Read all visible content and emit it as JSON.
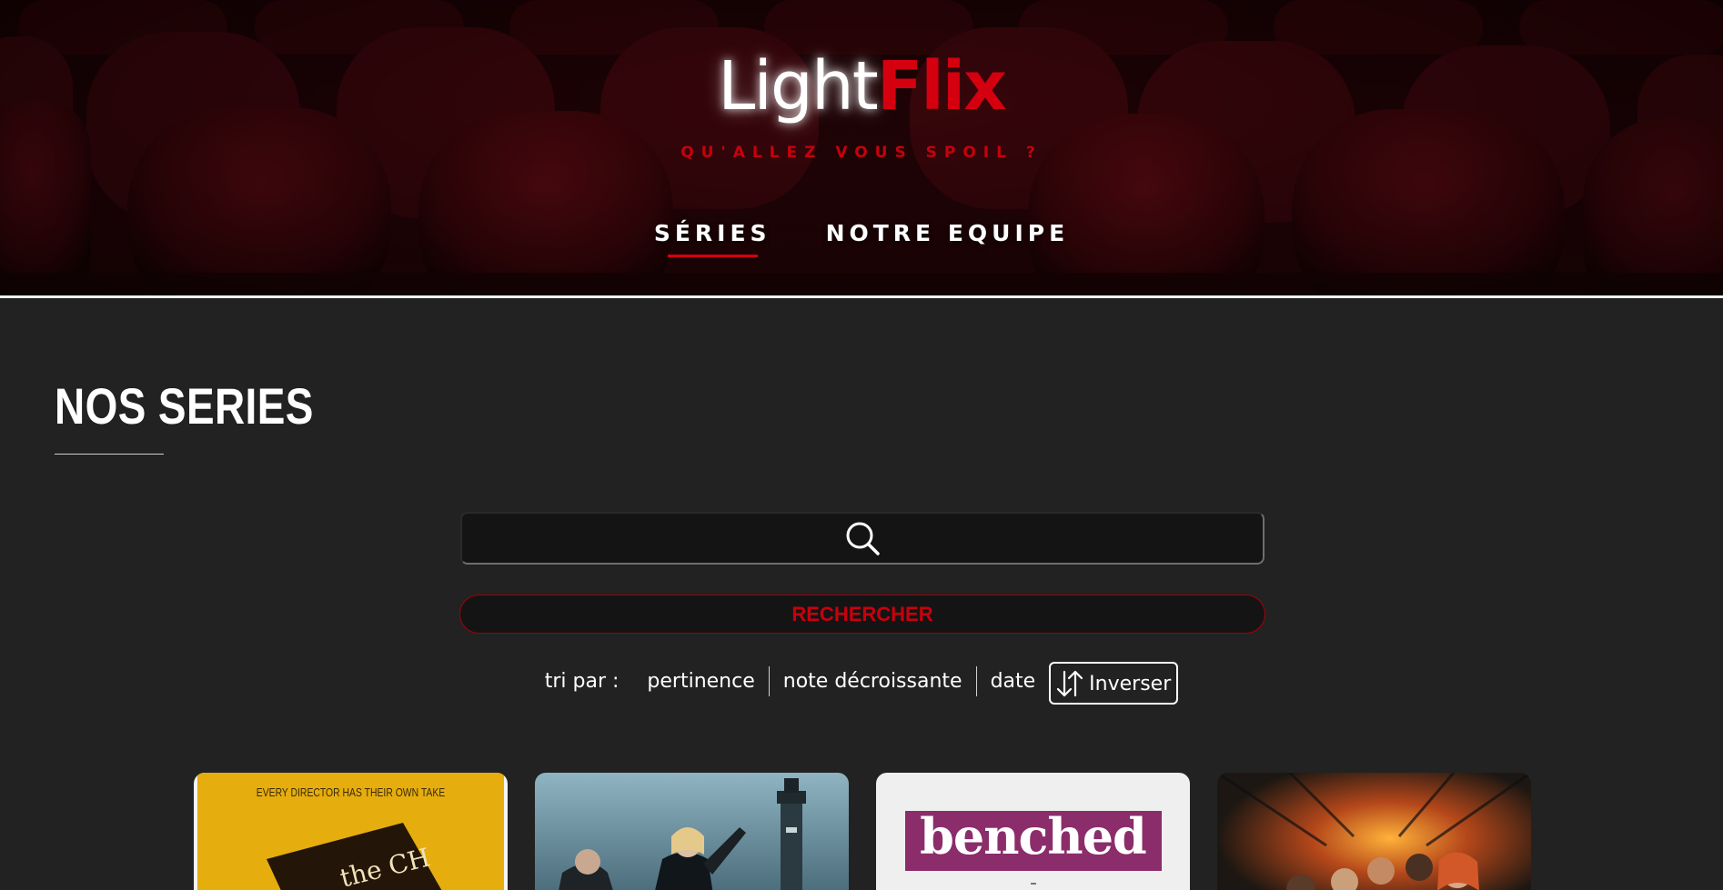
{
  "brand": {
    "name_light": "Light",
    "name_flix": "Flix",
    "tagline": "QU'ALLEZ VOUS SPOIL ?",
    "accent_color": "#d4000f"
  },
  "nav": {
    "items": [
      {
        "label": "SÉRIES",
        "active": true
      },
      {
        "label": "NOTRE EQUIPE",
        "active": false
      }
    ]
  },
  "main": {
    "section_title": "NOS SERIES",
    "search": {
      "value": "",
      "placeholder": "",
      "icon": "search-icon"
    },
    "search_button_label": "RECHERCHER",
    "sort": {
      "label": "tri par :",
      "options": [
        "pertinence",
        "note décroissante",
        "date"
      ],
      "invert_label": "Inverser",
      "invert_icon": "sort-arrows-icon"
    }
  },
  "cards": [
    {
      "poster_text_top": "EVERY DIRECTOR HAS THEIR OWN TAKE",
      "poster_text_main": "the CH"
    },
    {
      "poster_text_top": "",
      "poster_text_main": ""
    },
    {
      "poster_text_top": "",
      "poster_text_main": "benched"
    },
    {
      "poster_text_top": "",
      "poster_text_main": ""
    }
  ]
}
